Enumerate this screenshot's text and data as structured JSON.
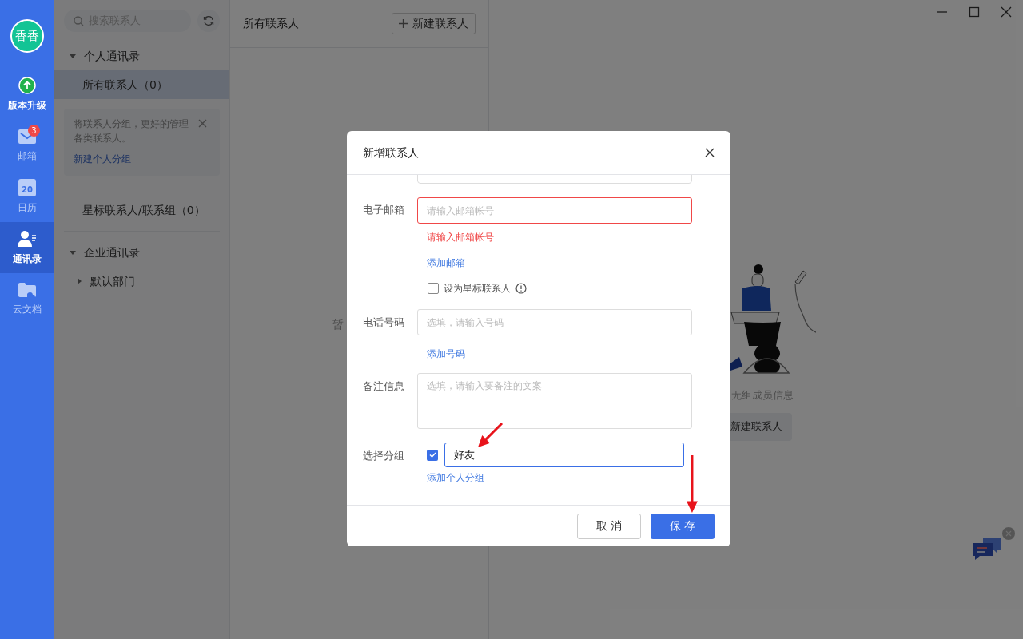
{
  "rail": {
    "avatar": "香香",
    "items": [
      {
        "kind": "upgrade",
        "label": "版本升级",
        "selected": false
      },
      {
        "kind": "mail",
        "label": "邮箱",
        "badge": "3",
        "selected": false
      },
      {
        "kind": "calendar",
        "label": "日历",
        "icon_text": "20",
        "selected": false
      },
      {
        "kind": "contacts",
        "label": "通讯录",
        "selected": true
      },
      {
        "kind": "docs",
        "label": "云文档",
        "selected": false
      }
    ]
  },
  "contact_panel": {
    "search": {
      "placeholder": "搜索联系人"
    },
    "tree": [
      {
        "kind": "group",
        "label": "个人通讯录",
        "expanded": true,
        "children": [
          {
            "label": "所有联系人（0）",
            "selected": true
          }
        ]
      },
      {
        "kind": "tip",
        "text": "将联系人分组，更好的管理各类联系人。",
        "link": "新建个人分组"
      },
      {
        "kind": "item",
        "label": "星标联系人/联系组（0）",
        "selected": false
      },
      {
        "kind": "group",
        "label": "企业通讯录",
        "expanded": true,
        "children": [
          {
            "label": "默认部门",
            "expanded": false
          }
        ]
      }
    ]
  },
  "list_pane": {
    "title": "所有联系人",
    "new_button": "新建联系人",
    "empty_text": "暂"
  },
  "detail_pane": {
    "empty_text": "无组成员信息",
    "button": "新建联系人"
  },
  "dialog": {
    "title": "新增联系人",
    "email": {
      "label": "电子邮箱",
      "placeholder": "请输入邮箱帐号",
      "error": "请输入邮箱帐号",
      "add_link": "添加邮箱",
      "star": {
        "label": "设为星标联系人",
        "checked": false
      }
    },
    "phone": {
      "label": "电话号码",
      "placeholder": "选填，请输入号码",
      "add_link": "添加号码"
    },
    "note": {
      "label": "备注信息",
      "placeholder": "选填，请输入要备注的文案"
    },
    "group": {
      "label": "选择分组",
      "checked": true,
      "value": "好友",
      "add_link": "添加个人分组"
    },
    "cancel": "取消",
    "save": "保存"
  }
}
